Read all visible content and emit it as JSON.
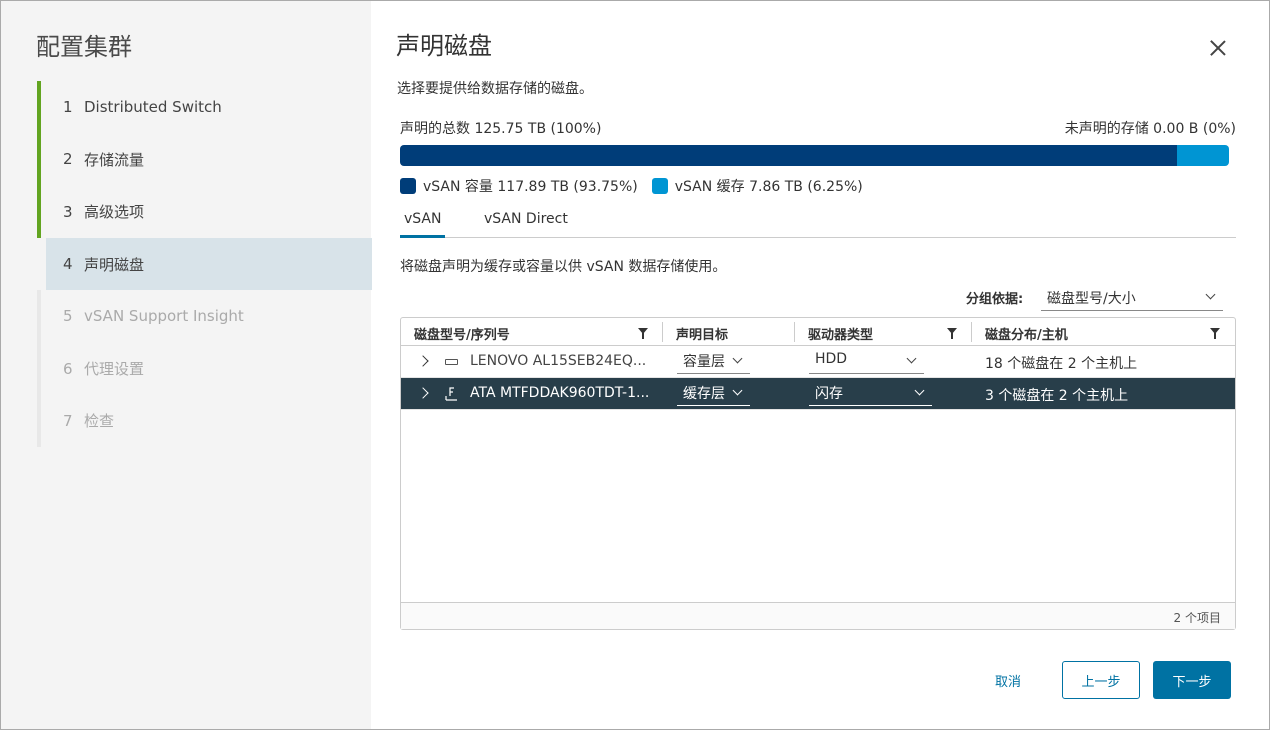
{
  "wizard": {
    "title": "配置集群",
    "steps": [
      {
        "num": "1",
        "label": "Distributed Switch",
        "state": "done"
      },
      {
        "num": "2",
        "label": "存储流量",
        "state": "done"
      },
      {
        "num": "3",
        "label": "高级选项",
        "state": "done"
      },
      {
        "num": "4",
        "label": "声明磁盘",
        "state": "active"
      },
      {
        "num": "5",
        "label": "vSAN Support Insight",
        "state": "disabled"
      },
      {
        "num": "6",
        "label": "代理设置",
        "state": "disabled"
      },
      {
        "num": "7",
        "label": "检查",
        "state": "disabled"
      }
    ]
  },
  "main": {
    "title": "声明磁盘",
    "subtitle": "选择要提供给数据存储的磁盘。",
    "total_claimed": "声明的总数 125.75 TB (100%)",
    "unclaimed": "未声明的存储 0.00 B (0%)",
    "capacity_fraction": 0.9375,
    "cache_fraction": 0.0625,
    "legend": {
      "capacity": "vSAN 容量 117.89 TB (93.75%)",
      "cache": "vSAN 缓存 7.86 TB (6.25%)"
    },
    "colors": {
      "capacity": "#003d79",
      "cache": "#0095d3",
      "accent": "#0072a3",
      "selected_row": "#283e4a",
      "step_done": "#62a420"
    },
    "tabs": [
      {
        "label": "vSAN",
        "active": true
      },
      {
        "label": "vSAN Direct",
        "active": false
      }
    ],
    "description": "将磁盘声明为缓存或容量以供 vSAN 数据存储使用。",
    "group_by": {
      "label": "分组依据:",
      "value": "磁盘型号/大小"
    },
    "grid": {
      "columns": [
        "磁盘型号/序列号",
        "声明目标",
        "驱动器类型",
        "磁盘分布/主机"
      ],
      "rows": [
        {
          "icon": "hdd-icon",
          "model": "LENOVO AL15SEB24EQ...",
          "claim": "容量层",
          "drive_type": "HDD",
          "distribution": "18 个磁盘在 2 个主机上",
          "selected": false
        },
        {
          "icon": "flash-icon",
          "model": "ATA MTFDDAK960TDT-1...",
          "claim": "缓存层",
          "drive_type": "闪存",
          "distribution": "3 个磁盘在 2 个主机上",
          "selected": true
        }
      ],
      "footer": "2 个项目"
    },
    "buttons": {
      "cancel": "取消",
      "back": "上一步",
      "next": "下一步"
    }
  }
}
